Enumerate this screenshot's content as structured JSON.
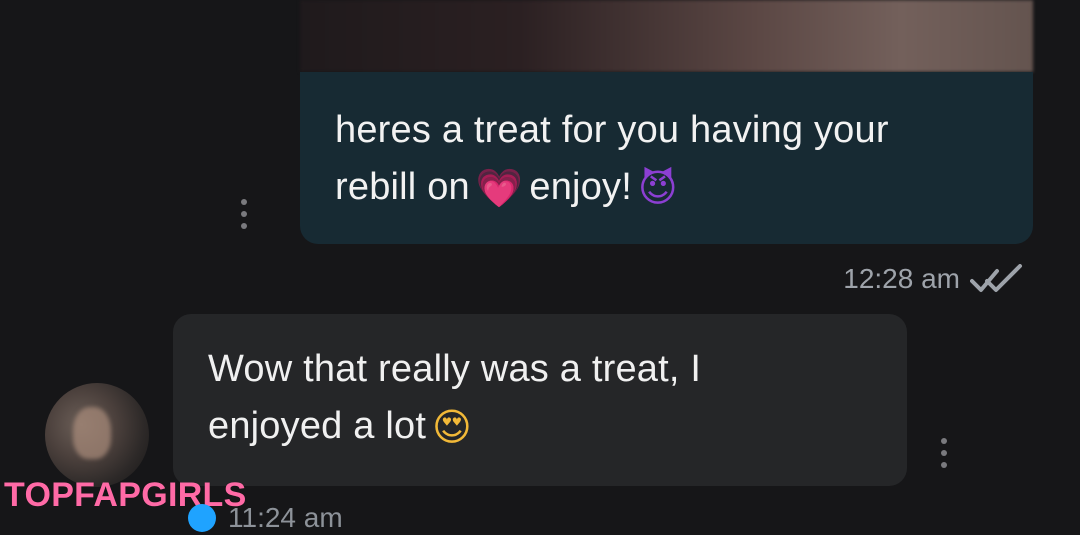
{
  "messages": {
    "sent": {
      "line1": "heres a treat for you having your",
      "line2_prefix": "rebill on",
      "line2_suffix": "enjoy!",
      "emoji_1_icon": "heart-emoji",
      "emoji_1": "💗",
      "emoji_2_icon": "smiling-devil-emoji",
      "emoji_2": "😈",
      "time": "12:28 am",
      "status_icon": "double-check-icon"
    },
    "received": {
      "line1": "Wow that really was a treat, I",
      "line2_prefix": "enjoyed a lot",
      "emoji_icon": "heart-eyes-emoji",
      "emoji": "😍",
      "time": "11:24 am",
      "status_icon": "blue-dot-icon"
    }
  },
  "watermark": {
    "text": "TOPFAPGIRLS"
  },
  "colors": {
    "background": "#161618",
    "sent_bubble": "#172a33",
    "received_bubble": "#252628",
    "watermark": "#ff6aa6",
    "accent_dot": "#1fa3ff"
  }
}
